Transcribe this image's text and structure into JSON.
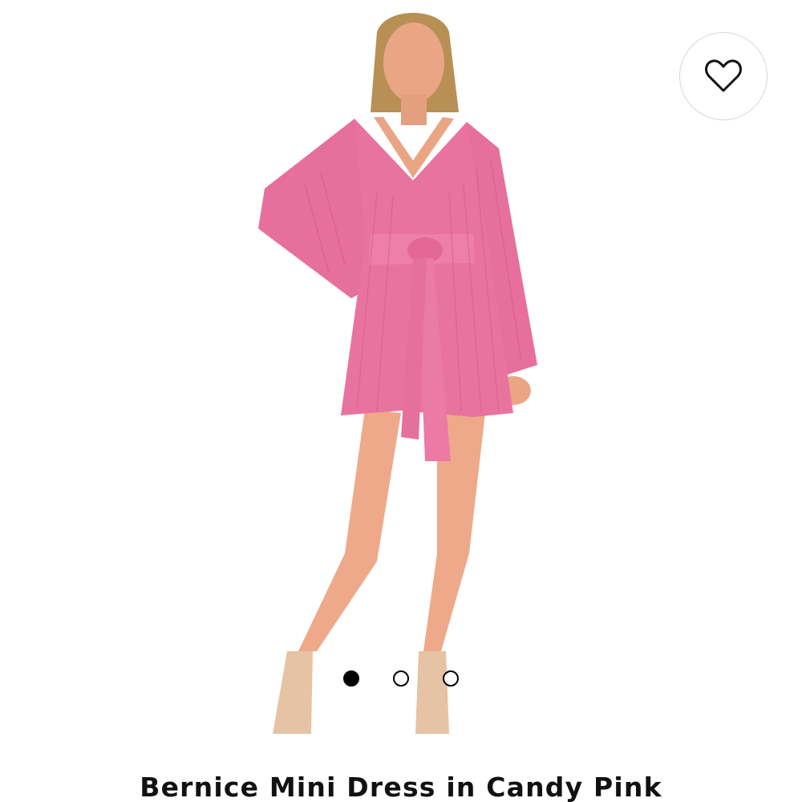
{
  "product": {
    "title": "Bernice Mini Dress in Candy Pink"
  },
  "gallery": {
    "image_count": 3,
    "active_index": 0
  },
  "wishlist": {
    "icon": "heart-outline-icon"
  },
  "colors": {
    "dress": "#e9739f",
    "skin": "#eea98a",
    "dot_active": "#000000",
    "text": "#111111"
  }
}
